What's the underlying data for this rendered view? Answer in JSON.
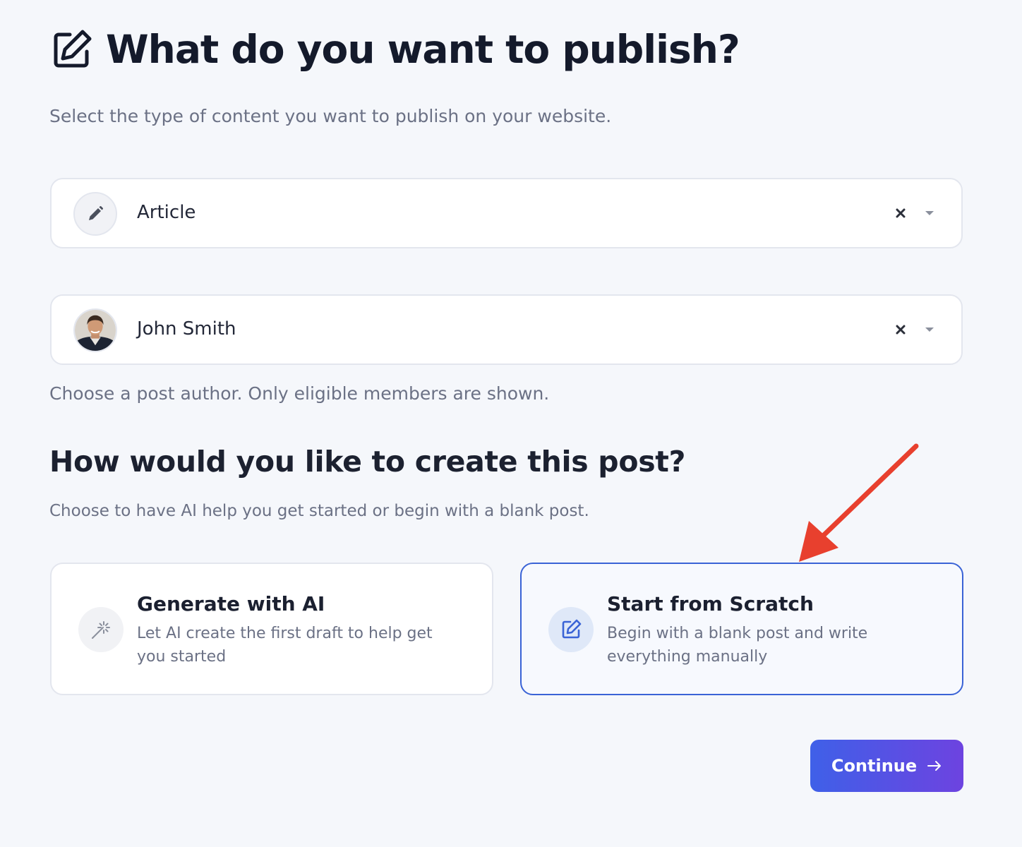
{
  "header": {
    "title": "What do you want to publish?",
    "title_icon": "edit-square-icon",
    "subtitle": "Select the type of content you want to publish on your website."
  },
  "content_type_select": {
    "value": "Article",
    "icon": "pencil-icon"
  },
  "author_select": {
    "value": "John Smith",
    "avatar": "author-avatar",
    "helper": "Choose a post author. Only eligible members are shown."
  },
  "creation": {
    "heading": "How would you like to create this post?",
    "subheading": "Choose to have AI help you get started or begin with a blank post.",
    "options": [
      {
        "title": "Generate with AI",
        "description": "Let AI create the first draft to help get you started",
        "icon": "magic-wand-icon",
        "selected": false
      },
      {
        "title": "Start from Scratch",
        "description": "Begin with a blank post and write everything manually",
        "icon": "edit-square-icon",
        "selected": true
      }
    ]
  },
  "actions": {
    "continue_label": "Continue",
    "continue_icon": "arrow-right-icon"
  },
  "colors": {
    "accent": "#3a63d6",
    "button_gradient_start": "#3f60e8",
    "button_gradient_end": "#6d43e0",
    "annotation_arrow": "#e8402e"
  }
}
